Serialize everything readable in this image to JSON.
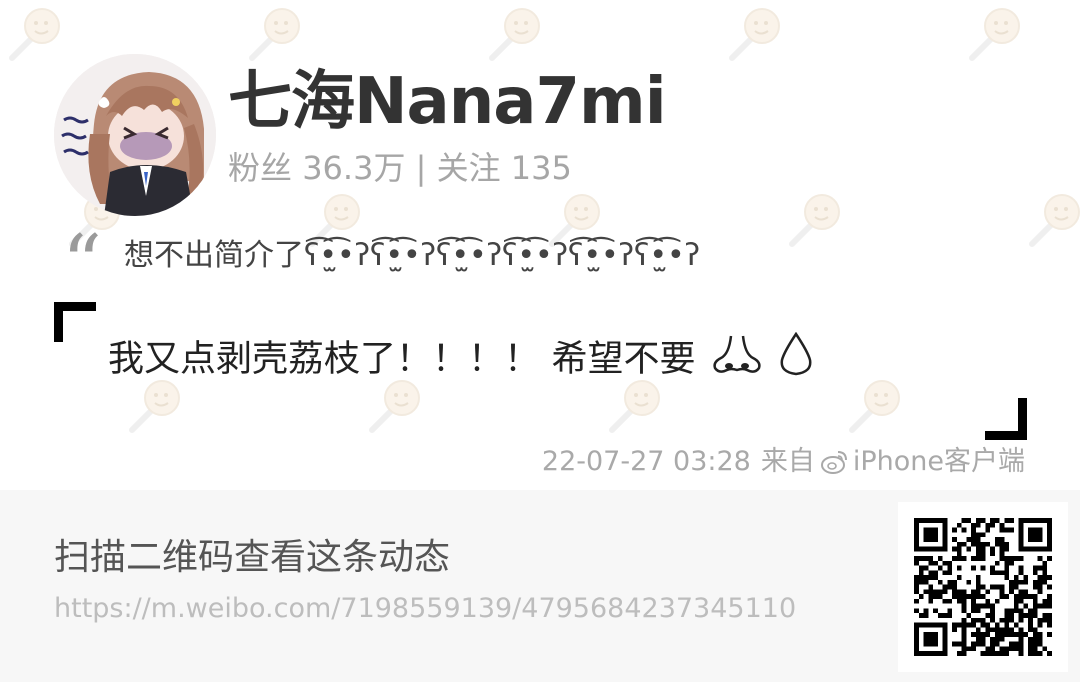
{
  "profile": {
    "name": "七海Nana7mi",
    "followers_label": "粉丝",
    "followers_value": "36.3万",
    "separator": "|",
    "following_label": "关注",
    "following_value": "135"
  },
  "bio": {
    "quote_mark": "“",
    "text": "想不出简介了ʕ͡•̫͡•ʔʕ͡•̫͡•ʔʕ͡•̫͡•ʔʕ͡•̫͡•ʔʕ͡•̫͡•ʔʕ͡•̫͡•ʔ"
  },
  "post": {
    "text": "我又点剥壳荔枝了！！！！ 希望不要",
    "emoji": [
      "nose-icon",
      "droplet-icon"
    ],
    "timestamp": "22-07-27 03:28",
    "source_prefix": "来自",
    "source": "iPhone客户端"
  },
  "footer": {
    "scan_text": "扫描二维码查看这条动态",
    "url": "https://m.weibo.com/7198559139/4795684237345110"
  },
  "colors": {
    "name": "#333333",
    "muted": "#a6a6a6",
    "footer_bg": "#f7f7f7"
  }
}
